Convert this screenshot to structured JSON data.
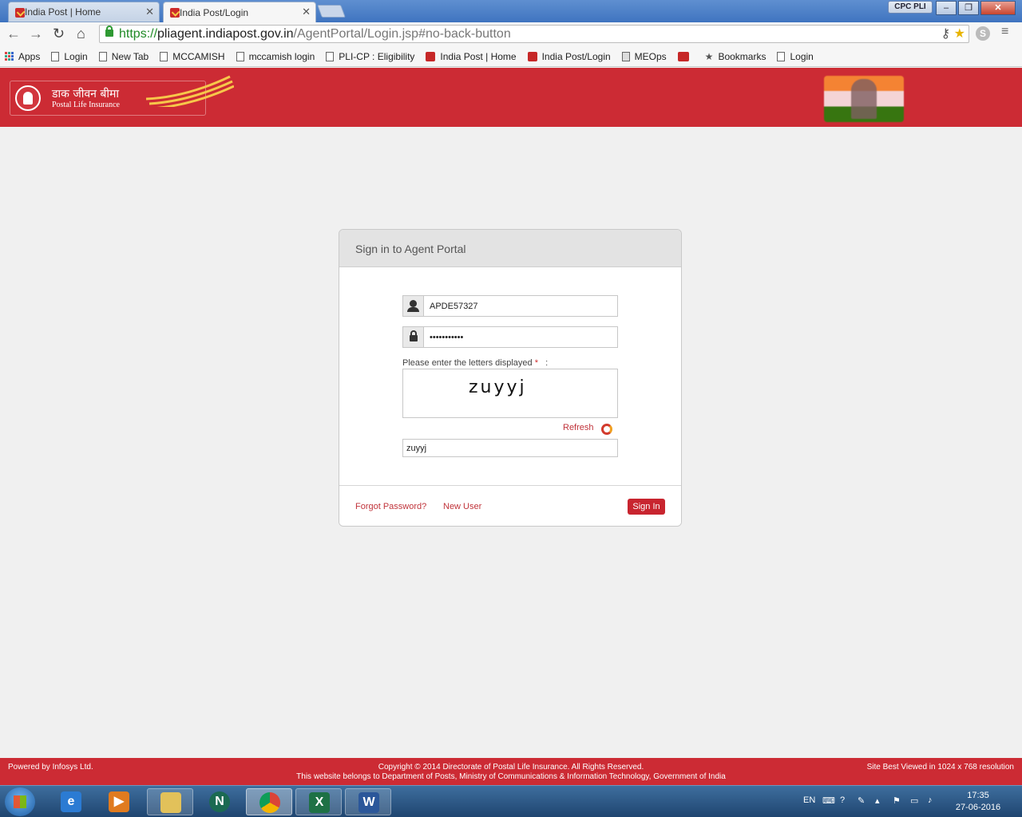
{
  "browser": {
    "tabs": [
      {
        "label": "India Post | Home",
        "active": false
      },
      {
        "label": "India Post/Login",
        "active": true
      }
    ],
    "profile": "CPC PLI",
    "url": {
      "scheme": "https://",
      "host": "pliagent.indiapost.gov.in",
      "path": "/AgentPortal/Login.jsp#no-back-button"
    },
    "bookmarks": [
      "Apps",
      "Login",
      "New Tab",
      "MCCAMISH",
      "mccamish login",
      "PLI-CP : Eligibility",
      "India Post | Home",
      "India Post/Login",
      "MEOps",
      "Bookmarks",
      "Login"
    ]
  },
  "header": {
    "logo_hindi": "डाक जीवन बीमा",
    "logo_english": "Postal Life Insurance"
  },
  "login": {
    "title": "Sign in to Agent Portal",
    "username_value": "APDE57327",
    "password_value": "•••••••••••",
    "captcha_label": "Please enter the letters displayed",
    "captcha_required_mark": "*",
    "captcha_colon": ":",
    "captcha_text": "zuyyj",
    "refresh_label": "Refresh",
    "captcha_input_value": "zuyyj",
    "forgot_password": "Forgot Password?",
    "new_user": "New User",
    "sign_in": "Sign In"
  },
  "footer": {
    "powered_by": "Powered by Infosys Ltd.",
    "copyright": "Copyright © 2014 Directorate of Postal Life Insurance. All Rights Reserved.",
    "ownership": "This website belongs to Department of Posts, Ministry of Communications & Information Technology, Government of India",
    "best_viewed": "Site Best Viewed in 1024 x 768 resolution"
  },
  "taskbar": {
    "tray_lang": "EN",
    "time": "17:35",
    "date": "27-06-2016"
  },
  "colors": {
    "brand_red": "#cc2b34",
    "link_red": "#c0333a"
  }
}
